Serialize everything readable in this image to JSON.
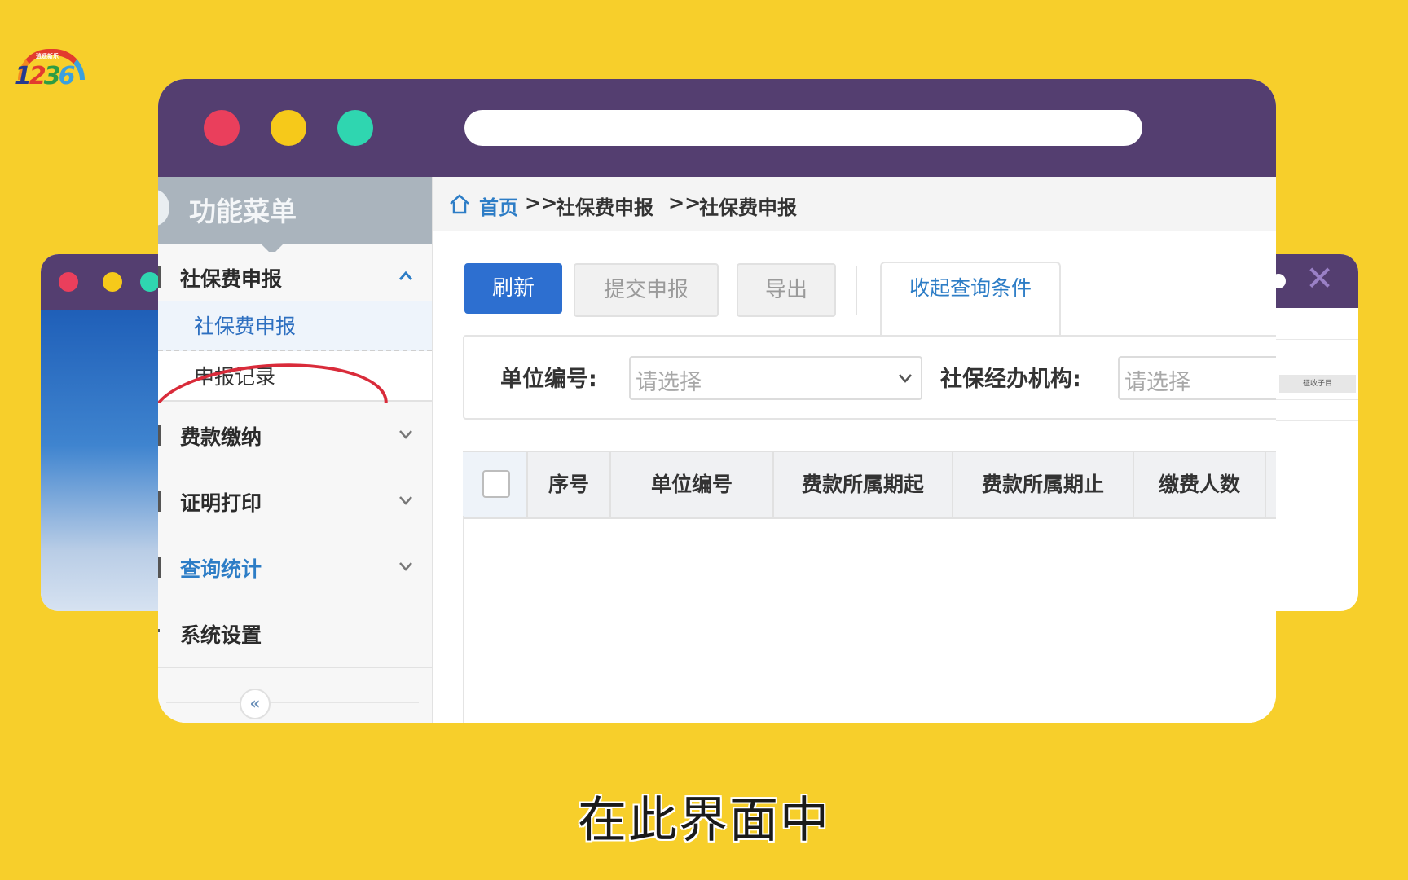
{
  "colors": {
    "background": "#f7cf2b",
    "titlebar": "#543e70",
    "dot_red": "#ea3f5c",
    "dot_yellow": "#f6c91a",
    "dot_green": "#2fd6b0",
    "primary": "#2d6fd0",
    "link": "#2d7dc6",
    "highlight_ring": "#d92b3a"
  },
  "logo": {
    "small_text": "逍遥新乐",
    "digits": [
      "1",
      "2",
      "3",
      "6"
    ]
  },
  "sidebar": {
    "title": "功能菜单",
    "groups": [
      {
        "label": "社保费申报",
        "expanded": true,
        "icon": "chevron-up-icon"
      },
      {
        "label": "费款缴纳",
        "expanded": false,
        "icon": "chevron-down-icon"
      },
      {
        "label": "证明打印",
        "expanded": false,
        "icon": "chevron-down-icon"
      },
      {
        "label": "查询统计",
        "expanded": false,
        "icon": "chevron-down-icon"
      },
      {
        "label": "系统设置"
      }
    ],
    "sub_items": [
      {
        "label": "社保费申报",
        "active": true
      },
      {
        "label": "申报记录",
        "active": false
      }
    ],
    "collapse_glyph": "«"
  },
  "breadcrumb": {
    "home": "首页",
    "sep": ">>",
    "level1": "社保费申报",
    "level2": "社保费申报"
  },
  "toolbar": {
    "refresh": "刷新",
    "submit": "提交申报",
    "export": "导出",
    "collapse_filter": "收起查询条件"
  },
  "filters": {
    "unit_label": "单位编号:",
    "unit_placeholder": "请选择",
    "agency_label": "社保经办机构:",
    "agency_placeholder": "请选择"
  },
  "table": {
    "columns": [
      "序号",
      "单位编号",
      "费款所属期起",
      "费款所属期止",
      "缴费人数"
    ]
  },
  "back_window_right": {
    "tag": "征收子目"
  },
  "caption": "在此界面中"
}
